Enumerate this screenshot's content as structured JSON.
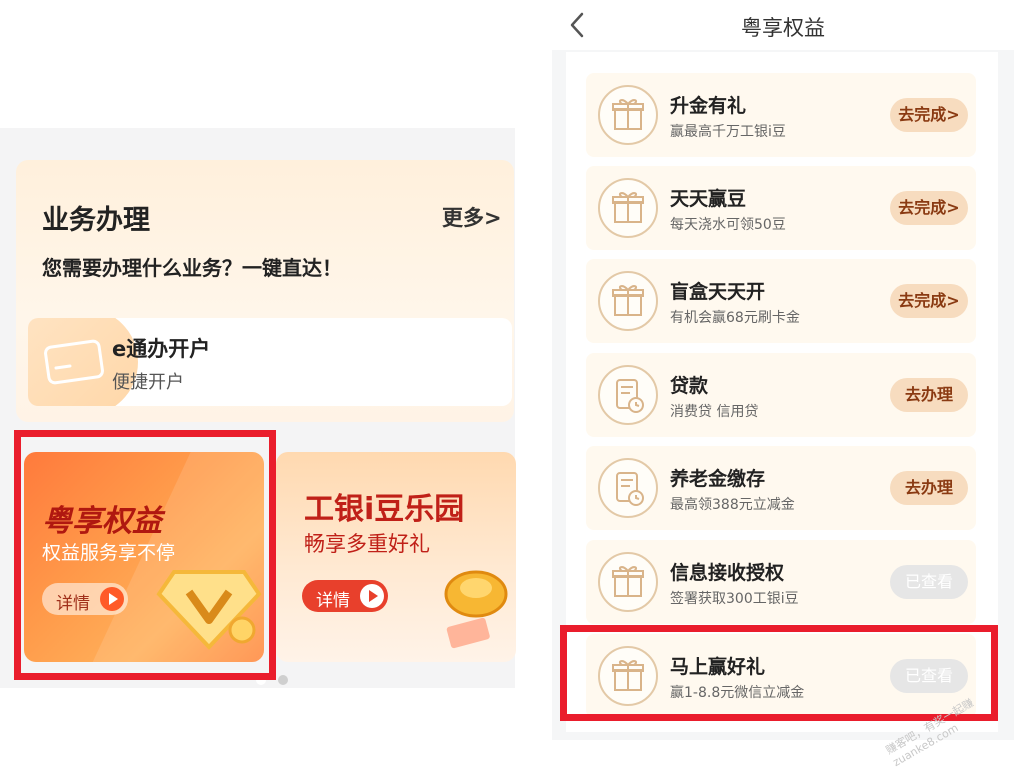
{
  "left": {
    "business": {
      "title": "业务办理",
      "more": "更多>",
      "subtitle": "您需要办理什么业务？一键直达！",
      "card": {
        "title": "e通办开户",
        "subtitle": "便捷开户",
        "icon": "card-icon"
      }
    },
    "promos": [
      {
        "title": "粤享权益",
        "subtitle": "权益服务享不停",
        "button": "详情",
        "icon": "diamond-icon"
      },
      {
        "title": "工银i豆乐园",
        "subtitle": "畅享多重好礼",
        "button": "详情",
        "icon": "gold-ingot-icon"
      }
    ],
    "carousel": {
      "active_index": 0,
      "count": 2
    }
  },
  "right": {
    "header": {
      "title": "粤享权益",
      "back_icon": "chevron-left-icon"
    },
    "items": [
      {
        "title": "升金有礼",
        "subtitle": "赢最高千万工银i豆",
        "button": "去完成>",
        "icon": "gift-icon",
        "state": "active"
      },
      {
        "title": "天天赢豆",
        "subtitle": "每天浇水可领50豆",
        "button": "去完成>",
        "icon": "gift-icon",
        "state": "active"
      },
      {
        "title": "盲盒天天开",
        "subtitle": "有机会赢68元刷卡金",
        "button": "去完成>",
        "icon": "gift-icon",
        "state": "active"
      },
      {
        "title": "贷款",
        "subtitle": "消费贷 信用贷",
        "button": "去办理",
        "icon": "document-clock-icon",
        "state": "active"
      },
      {
        "title": "养老金缴存",
        "subtitle": "最高领388元立减金",
        "button": "去办理",
        "icon": "document-clock-icon",
        "state": "active"
      },
      {
        "title": "信息接收授权",
        "subtitle": "签署获取300工银i豆",
        "button": "已查看",
        "icon": "gift-icon",
        "state": "disabled"
      },
      {
        "title": "马上赢好礼",
        "subtitle": "赢1-8.8元微信立减金",
        "button": "已查看",
        "icon": "gift-icon",
        "state": "disabled"
      }
    ]
  },
  "watermark": "赚客吧，有奖一起赚 zuanke8.com",
  "colors": {
    "highlight": "#ea1d2c",
    "accent": "#ff7a3c",
    "pill": "#f7dcbf",
    "pill_text": "#8a3a12"
  }
}
